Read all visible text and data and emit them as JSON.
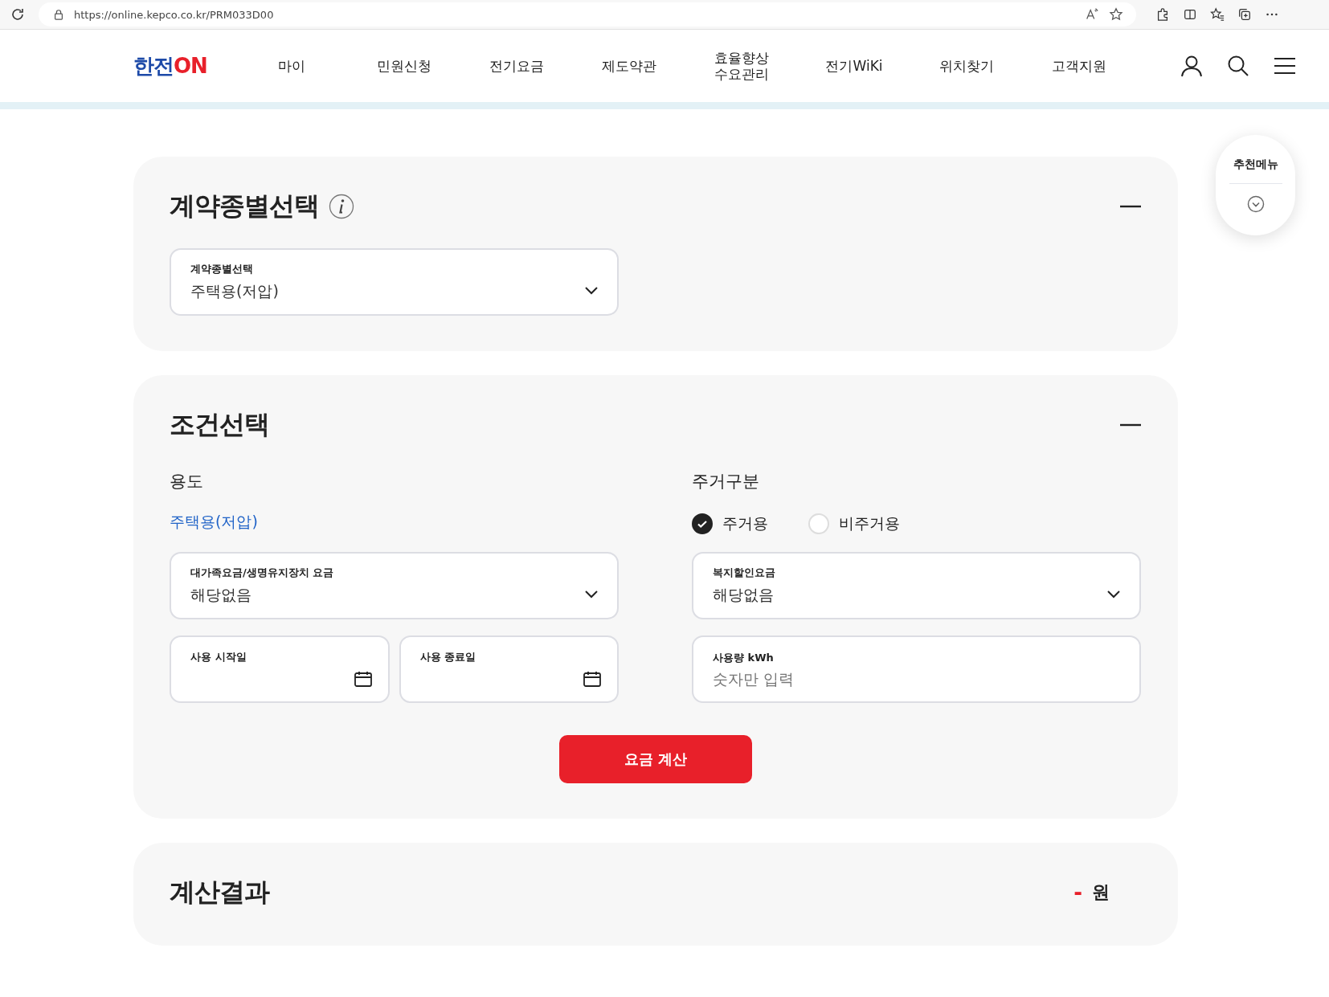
{
  "browser": {
    "url": "https://online.kepco.co.kr/PRM033D00"
  },
  "header": {
    "logo": [
      "한전",
      "ON"
    ],
    "nav": [
      "마이",
      "민원신청",
      "전기요금",
      "제도약관",
      "효율향상\n수요관리",
      "전기WiKi",
      "위치찾기",
      "고객지원"
    ]
  },
  "recommend": {
    "label": "추천메뉴"
  },
  "contract": {
    "title": "계약종별선택",
    "expanded": true,
    "select": {
      "label": "계약종별선택",
      "value": "주택용(저압)"
    }
  },
  "conditions": {
    "title": "조건선택",
    "expanded": true,
    "usage": {
      "label": "용도",
      "value": "주택용(저압)"
    },
    "residence": {
      "label": "주거구분",
      "options": [
        {
          "label": "주거용",
          "selected": true
        },
        {
          "label": "비주거용",
          "selected": false
        }
      ]
    },
    "family_select": {
      "label": "대가족요금/생명유지장치 요금",
      "value": "해당없음"
    },
    "welfare_select": {
      "label": "복지할인요금",
      "value": "해당없음"
    },
    "start_date": {
      "label": "사용 시작일"
    },
    "end_date": {
      "label": "사용 종료일"
    },
    "kwh": {
      "label": "사용량 kWh",
      "placeholder": "숫자만 입력"
    },
    "button": "요금 계산"
  },
  "result": {
    "title": "계산결과",
    "value": "-",
    "unit": "원"
  }
}
